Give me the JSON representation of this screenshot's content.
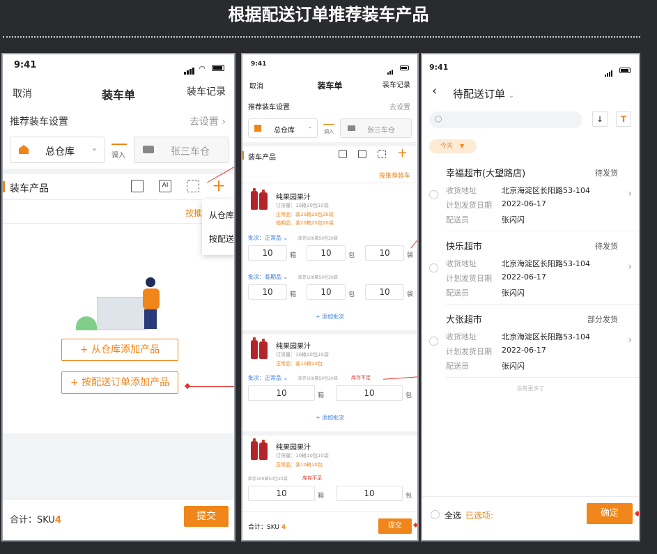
{
  "page_title": "根据配送订单推荐装车产品",
  "status_time": "9:41",
  "screen1": {
    "cancel": "取消",
    "title": "装车单",
    "record": "装车记录",
    "settings_label": "推荐装车设置",
    "settings_action": "去设置",
    "warehouse": "总仓库",
    "transfer_in": "调入",
    "target_vehicle": "张三车仓",
    "section_title": "装车产品",
    "recommend_prefix": "按推",
    "menu_from_warehouse": "从仓库",
    "menu_by_delivery": "按配送",
    "add_from_warehouse": "+ 从仓库添加产品",
    "add_by_delivery": "+ 按配送订单添加产品",
    "total_label": "合计：SKU",
    "total_value": "4",
    "submit": "提交"
  },
  "screen2": {
    "cancel": "取消",
    "title": "装车单",
    "record": "装车记录",
    "settings_label": "推荐装车设置",
    "settings_action": "去设置",
    "warehouse": "总仓库",
    "transfer_in": "调入",
    "target_vehicle": "张三车仓",
    "section_title": "装车产品",
    "recommend_link": "按推荐装车",
    "products": [
      {
        "name": "纯果园果汁",
        "order_qty": "订货量：10箱10包10袋",
        "normal": "正常品：装20箱20包20袋",
        "expiring": "临期品：装20箱20包20袋",
        "batches": [
          {
            "label": "批次：正常品",
            "stock": "库存100箱50包20袋",
            "warn": "",
            "v1": "10",
            "u1": "箱",
            "v2": "10",
            "u2": "包",
            "v3": "10",
            "u3": "袋"
          },
          {
            "label": "批次：临期品",
            "stock": "库存100箱50包20袋",
            "warn": "",
            "v1": "10",
            "u1": "箱",
            "v2": "10",
            "u2": "包",
            "v3": "10",
            "u3": "袋"
          }
        ],
        "add_batch": "+ 添加批次"
      },
      {
        "name": "纯果园果汁",
        "order_qty": "订货量：10箱10包10袋",
        "normal": "正常品：装10箱10包",
        "expiring": "",
        "batches": [
          {
            "label": "批次：正常品",
            "stock": "库存100箱50包20袋",
            "warn": "库存不足",
            "v1": "10",
            "u1": "箱",
            "v2": "10",
            "u2": "包"
          }
        ],
        "add_batch": "+ 添加批次"
      },
      {
        "name": "纯果园果汁",
        "order_qty": "订货量：10箱10包10袋",
        "normal": "正常品：装10箱10包",
        "stock_line": "库存100箱50包20袋",
        "warn": "库存不足",
        "v1": "10",
        "u1": "箱",
        "v2": "10",
        "u2": "包"
      }
    ],
    "total_label": "合计：SKU",
    "total_value": "4",
    "submit": "提交"
  },
  "screen3": {
    "title": "待配送订单",
    "filter_today": "今天",
    "orders": [
      {
        "name": "幸福超市(大望路店)",
        "status": "待发货",
        "addr_label": "收货地址",
        "addr": "北京海淀区长阳路53-104",
        "date_label": "计划发货日期",
        "date": "2022-06-17",
        "courier_label": "配送员",
        "courier": "张闪闪"
      },
      {
        "name": "快乐超市",
        "status": "待发货",
        "addr_label": "收货地址",
        "addr": "北京海淀区长阳路53-104",
        "date_label": "计划发货日期",
        "date": "2022-06-17",
        "courier_label": "配送员",
        "courier": "张闪闪"
      },
      {
        "name": "大张超市",
        "status": "部分发货",
        "addr_label": "收货地址",
        "addr": "北京海淀区长阳路53-104",
        "date_label": "计划发货日期",
        "date": "2022-06-17",
        "courier_label": "配送员",
        "courier": "张闪闪"
      }
    ],
    "no_more": "没有更多了",
    "select_all": "全选",
    "selected_label": "已选项:",
    "confirm": "确定"
  },
  "colors": {
    "accent": "#f08519",
    "warn": "#e5352b",
    "link": "#3a7bd5"
  }
}
